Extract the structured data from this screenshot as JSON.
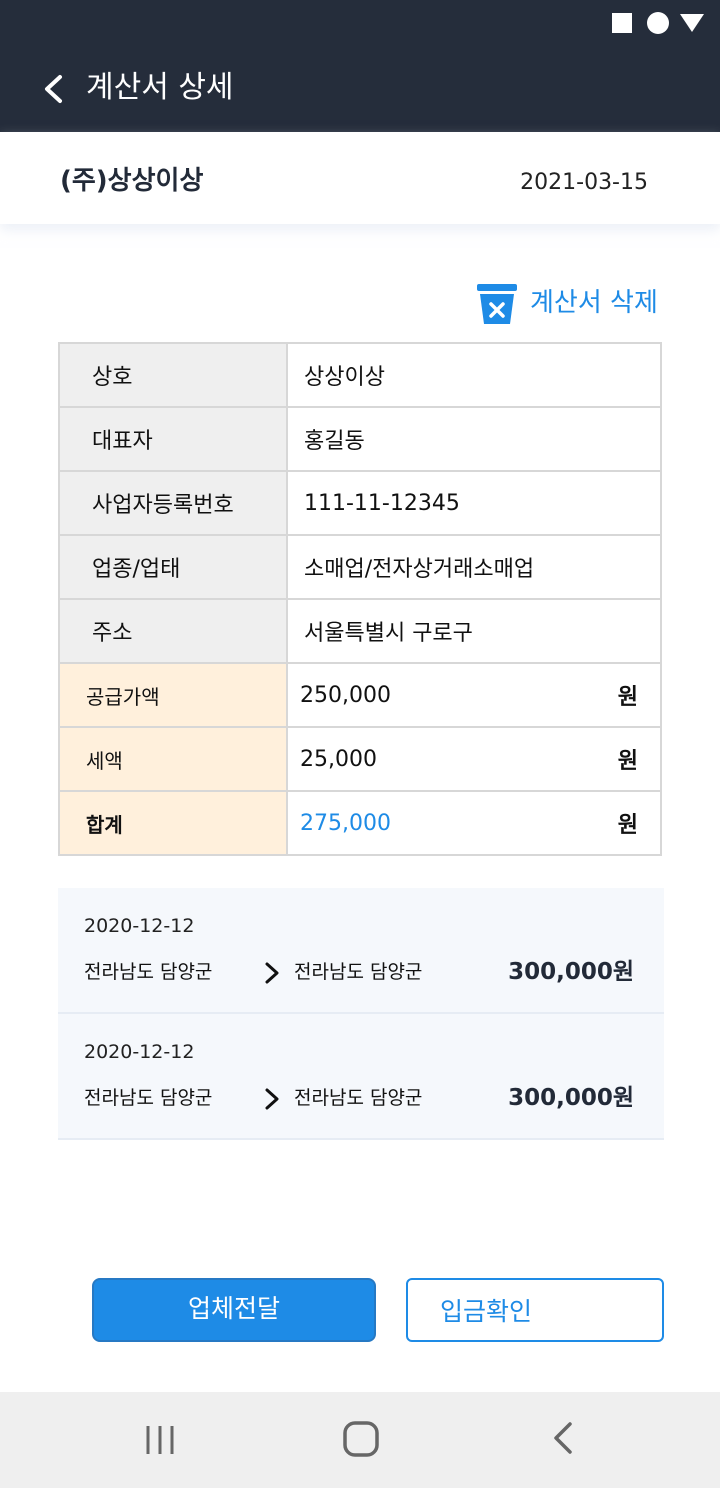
{
  "app_bar": {
    "title": "계산서 상세"
  },
  "company": {
    "name": "(주)상상이상",
    "date": "2021-03-15"
  },
  "actions": {
    "delete_label": "계산서 삭제",
    "send_label": "업체전달",
    "confirm_label": "입금확인"
  },
  "info_rows": [
    {
      "label": "상호",
      "value": "상상이상"
    },
    {
      "label": "대표자",
      "value": "홍길동"
    },
    {
      "label": "사업자등록번호",
      "value": "111-11-12345"
    },
    {
      "label": "업종/업태",
      "value": "소매업/전자상거래소매업"
    },
    {
      "label": "주소",
      "value": "서울특별시 구로구"
    }
  ],
  "amount_rows": [
    {
      "label": "공급가액",
      "value": "250,000",
      "unit": "원"
    },
    {
      "label": "세액",
      "value": "25,000",
      "unit": "원"
    },
    {
      "label": "합계",
      "value": "275,000",
      "unit": "원"
    }
  ],
  "deliveries": [
    {
      "date": "2020-12-12",
      "from": "전라남도 담양군",
      "to": "전라남도 담양군",
      "price": "300,000원"
    },
    {
      "date": "2020-12-12",
      "from": "전라남도 담양군",
      "to": "전라남도 담양군",
      "price": "300,000원"
    }
  ],
  "colors": {
    "header_bg": "#252d3b",
    "accent": "#1e8be6",
    "amount_label_bg": "#fff0dc",
    "info_label_bg": "#efefef"
  }
}
